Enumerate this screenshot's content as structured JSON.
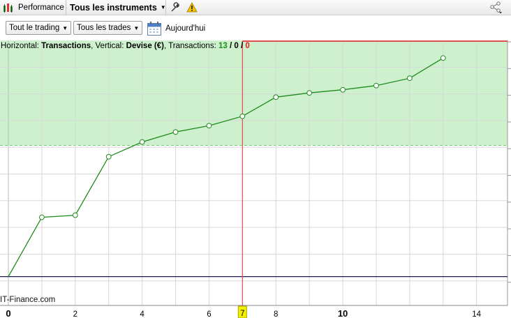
{
  "toolbar": {
    "performance_label": "Performance",
    "instrument_selector": "Tous les instruments",
    "icons": [
      "chart-app-icon",
      "wrench-icon",
      "warning-icon",
      "share-icon"
    ]
  },
  "filters": {
    "trading_filter": "Tout le trading",
    "trades_filter": "Tous les trades",
    "date_label": "Aujourd'hui"
  },
  "chart_info": {
    "horizontal_label": "Horizontal:",
    "horizontal_value": "Transactions",
    "vertical_label": "Vertical:",
    "vertical_value": "Devise (€)",
    "transactions_label": "Transactions:",
    "count_green": "13",
    "count_black": "0",
    "count_red": "0",
    "sep": "/"
  },
  "watermark": "IT-Finance.com",
  "chart_data": {
    "type": "line",
    "x": [
      0,
      1,
      2,
      3,
      4,
      5,
      6,
      7,
      8,
      9,
      10,
      11,
      12,
      13
    ],
    "values": [
      0,
      2.26,
      2.34,
      4.57,
      5.13,
      5.51,
      5.75,
      6.11,
      6.84,
      7.0,
      7.12,
      7.28,
      7.56,
      8.33
    ],
    "xlim": [
      0,
      14.8
    ],
    "ylim": [
      -1.1,
      9.0
    ],
    "x_ticks": [
      "0",
      "2",
      "4",
      "6",
      "8",
      "10",
      "14"
    ],
    "bold_ticks": [
      "0",
      "10"
    ],
    "cursor_x": 7,
    "cursor_label": "7",
    "green_zone_threshold": 5.0,
    "colors": {
      "line": "#1e8a1e",
      "zone": "#cdf0cd",
      "cursor": "#e05050",
      "cursor_label_bg": "#f2f200",
      "zero_line": "#1a1a4a"
    }
  }
}
